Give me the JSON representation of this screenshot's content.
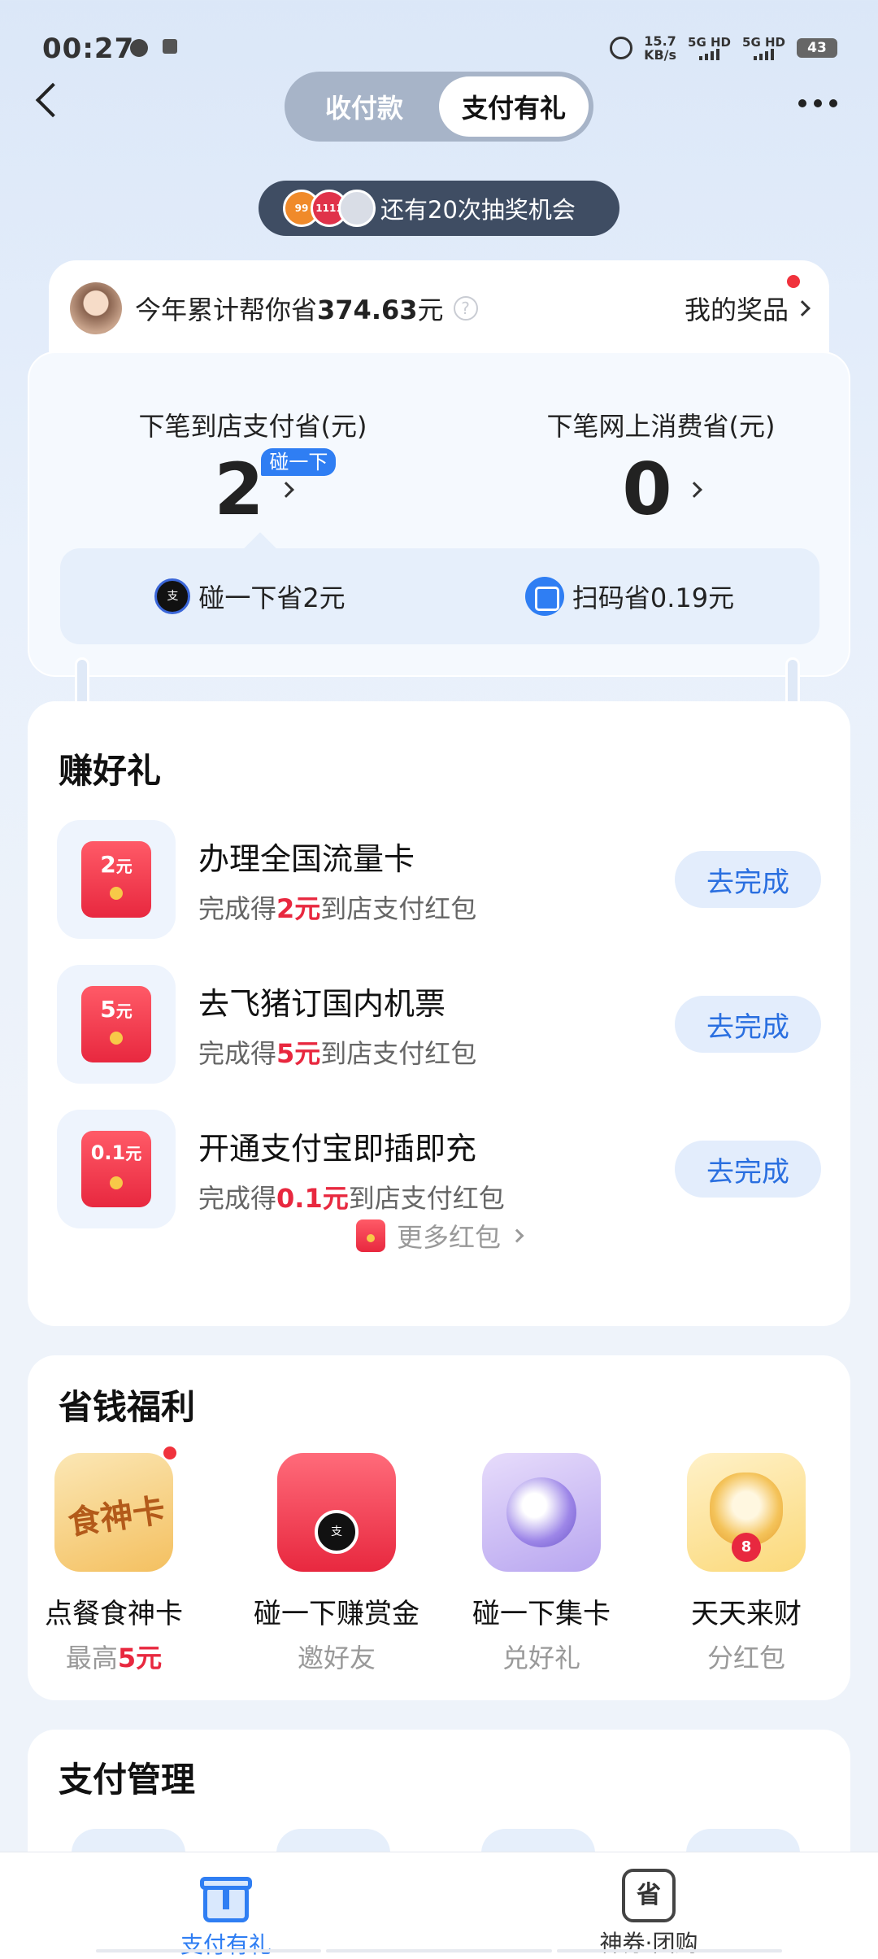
{
  "status_bar": {
    "time": "00:27",
    "net_speed": "15.7",
    "net_unit": "KB/s",
    "sim1": "5G HD",
    "sim2": "5G HD",
    "battery": "43"
  },
  "header": {
    "tabs": [
      {
        "label": "收付款",
        "active": false
      },
      {
        "label": "支付有礼",
        "active": true
      }
    ]
  },
  "lottery": {
    "badge1": "99",
    "badge2": "1111",
    "text": "还有20次抽奖机会"
  },
  "savings": {
    "prefix": "今年累计帮你省",
    "amount": "374.63",
    "suffix": "元",
    "my_prize": "我的奖品",
    "store": {
      "label": "下笔到店支付省(元)",
      "amount": "2",
      "badge": "碰一下"
    },
    "online": {
      "label": "下笔网上消费省(元)",
      "amount": "0"
    },
    "methods": [
      {
        "icon": "nfc-touch-icon",
        "text": "碰一下省2元"
      },
      {
        "icon": "scan-icon",
        "text": "扫码省0.19元"
      }
    ]
  },
  "earn": {
    "title": "赚好礼",
    "tasks": [
      {
        "amount": "2",
        "unit": "元",
        "title": "办理全国流量卡",
        "desc_pre": "完成得",
        "desc_hl": "2元",
        "desc_post": "到店支付红包",
        "button": "去完成"
      },
      {
        "amount": "5",
        "unit": "元",
        "title": "去飞猪订国内机票",
        "desc_pre": "完成得",
        "desc_hl": "5元",
        "desc_post": "到店支付红包",
        "button": "去完成"
      },
      {
        "amount": "0.1",
        "unit": "元",
        "title": "开通支付宝即插即充",
        "desc_pre": "完成得",
        "desc_hl": "0.1元",
        "desc_post": "到店支付红包",
        "button": "去完成"
      }
    ],
    "more": "更多红包"
  },
  "welfare": {
    "title": "省钱福利",
    "items": [
      {
        "icon": "food-card-icon",
        "icon_text": "食神卡",
        "name": "点餐食神卡",
        "sub_pre": "最高",
        "sub_hl": "5元",
        "has_dot": true
      },
      {
        "icon": "red-envelope-touch-icon",
        "name": "碰一下赚赏金",
        "sub": "邀好友"
      },
      {
        "icon": "card-collect-icon",
        "name": "碰一下集卡",
        "sub": "兑好礼"
      },
      {
        "icon": "lucky-mascot-icon",
        "coin": "8",
        "name": "天天来财",
        "sub": "分红包"
      }
    ]
  },
  "payment_mgmt": {
    "title": "支付管理"
  },
  "bottom_nav": {
    "items": [
      {
        "icon": "gift-icon",
        "label": "支付有礼",
        "active": true
      },
      {
        "icon": "coupon-save-icon",
        "icon_text": "省",
        "label": "神券·团购",
        "active": false
      }
    ]
  },
  "colors": {
    "accent": "#2f7ef3",
    "highlight_red": "#e8283f",
    "pill_bg": "#3f4d63"
  }
}
